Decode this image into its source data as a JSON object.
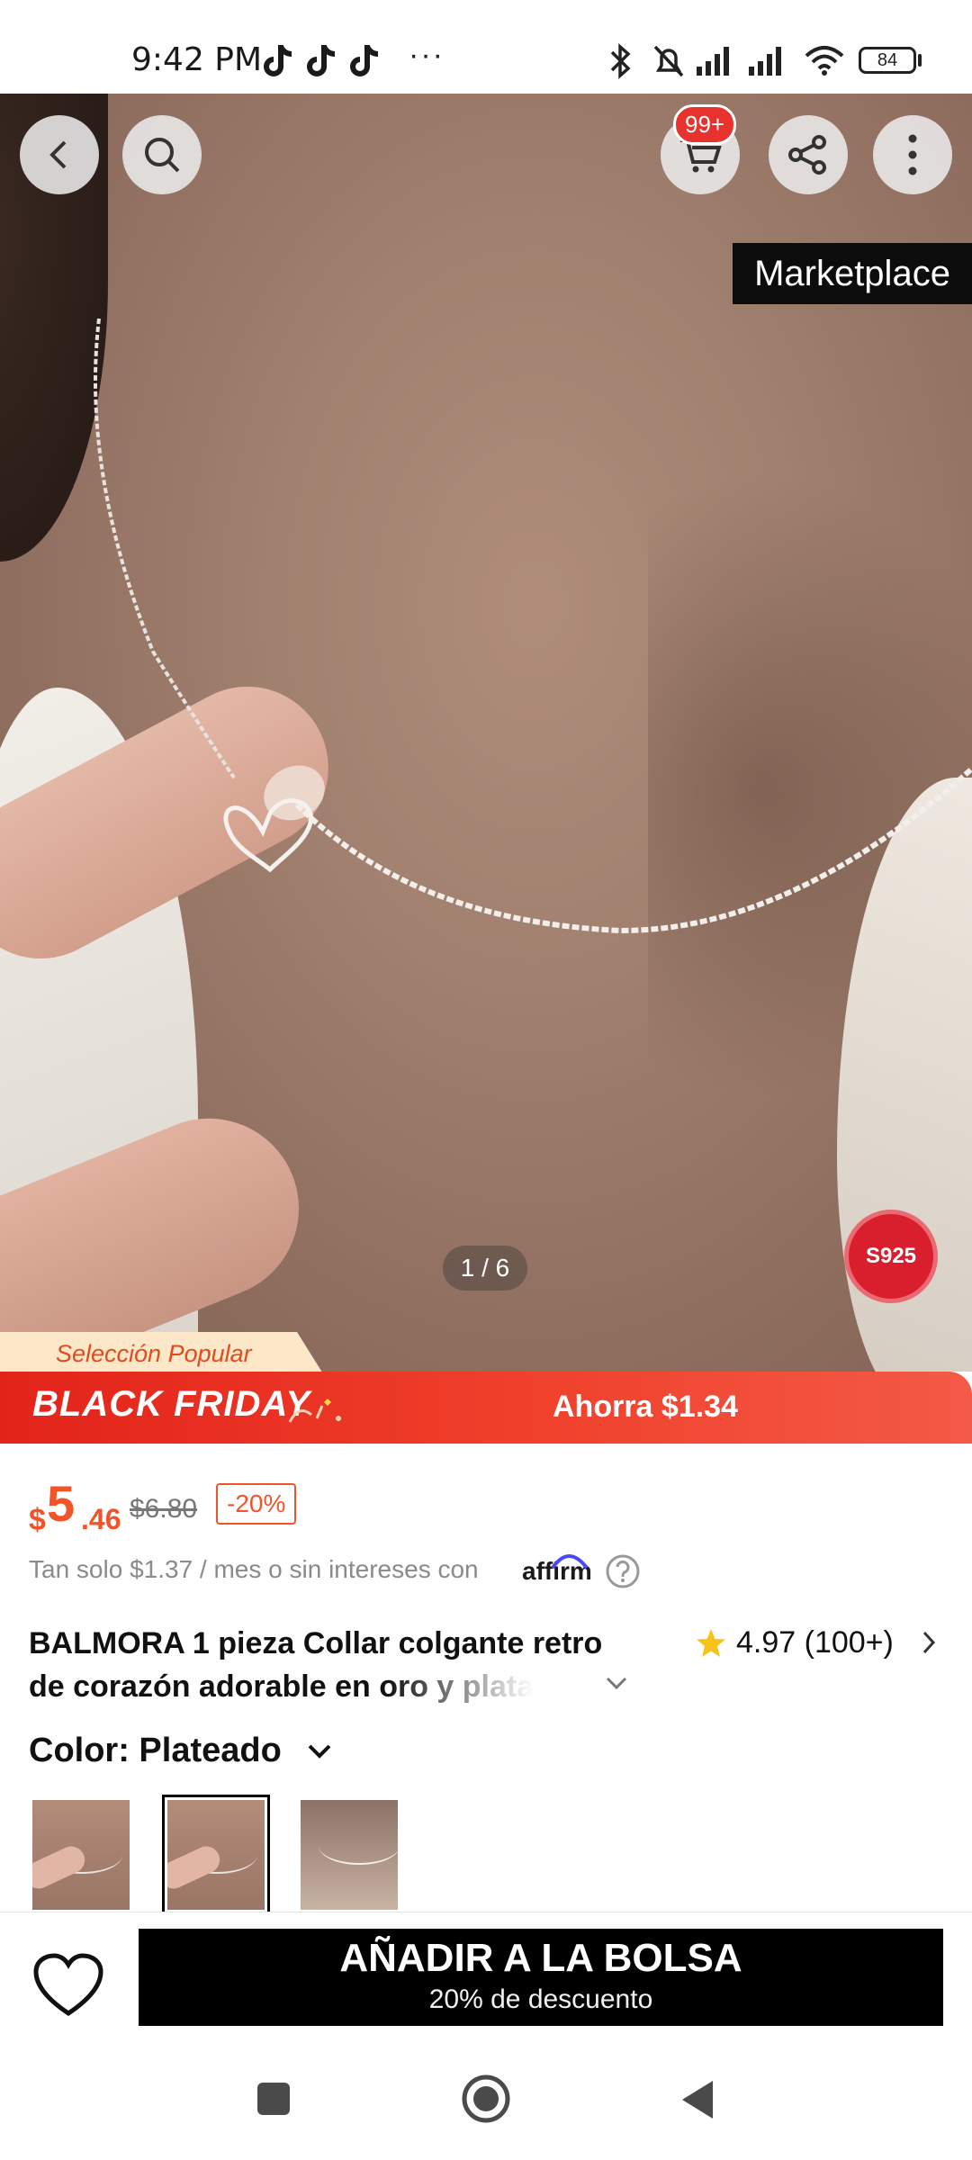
{
  "status_bar": {
    "time": "9:42 PM",
    "notification_icons": [
      "tiktok-icon",
      "tiktok-icon",
      "tiktok-icon"
    ],
    "more": "···",
    "battery": "84",
    "icons": [
      "bluetooth-icon",
      "bell-muted-icon",
      "signal-icon",
      "signal-icon",
      "wifi-icon",
      "battery-icon"
    ]
  },
  "header": {
    "back_icon": "chevron-left-icon",
    "search_icon": "search-icon",
    "cart_badge": "99+",
    "share_icon": "share-icon",
    "menu_icon": "more-vertical-icon"
  },
  "gallery": {
    "marketplace_tag": "Marketplace",
    "pager": "1 / 6",
    "material_badge": "S925",
    "popular_tag": "Selección Popular"
  },
  "promo_banner": {
    "title": "BLACK FRIDAY",
    "savings": "Ahorra $1.34",
    "colors": {
      "start": "#e2231a",
      "end": "#f35a47"
    }
  },
  "price": {
    "currency": "$",
    "integer": "5",
    "decimal": ".46",
    "original": "$6.80",
    "discount": "-20%",
    "color": "#f2542a"
  },
  "installments": {
    "text": "Tan solo $1.37 / mes o sin intereses con",
    "provider": "affirm"
  },
  "product": {
    "title_line1": "BALMORA 1 pieza Collar colgante retro",
    "title_line2": "de corazón adorable en oro y plata",
    "rating": "4.97 (100+)"
  },
  "color_selector": {
    "label": "Color: Plateado",
    "swatches": [
      "swatch-1",
      "swatch-2",
      "swatch-3"
    ],
    "selected_index": 1
  },
  "action_bar": {
    "wishlist_icon": "heart-icon",
    "add_to_bag": "AÑADIR A LA BOLSA",
    "add_to_bag_sub": "20% de descuento"
  },
  "nav": {
    "recents_icon": "square-icon",
    "home_icon": "circle-icon",
    "back_icon": "triangle-back-icon"
  }
}
